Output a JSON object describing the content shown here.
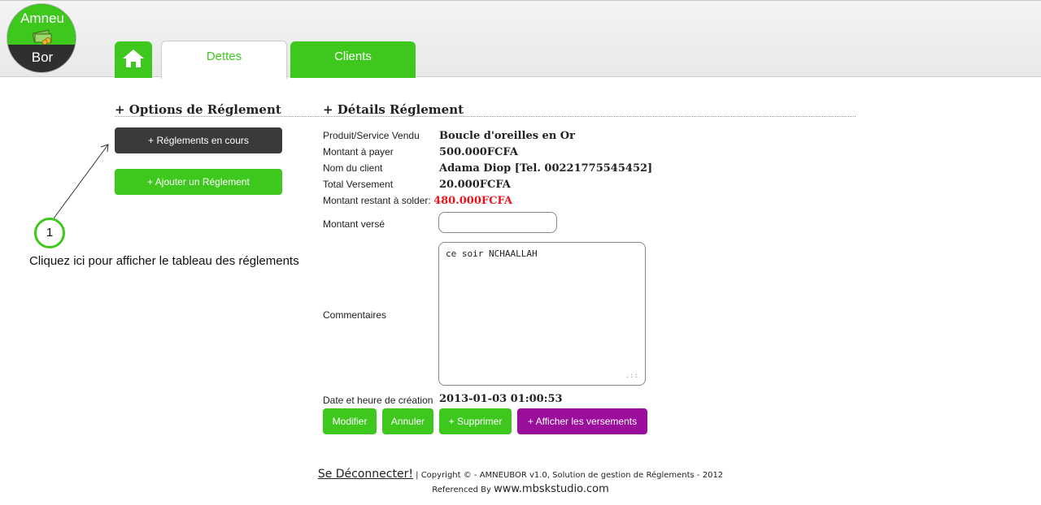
{
  "logo": {
    "line1": "Amneu",
    "line2": "Bor",
    "icon": "money-icon"
  },
  "tabs": {
    "home_icon": "home-icon",
    "dettes": "Dettes",
    "clients": "Clients"
  },
  "options": {
    "title": "+ Options de Réglement",
    "reglements_en_cours": "+ Réglements en cours",
    "ajouter_reglement": "+ Ajouter un Réglement"
  },
  "annotation": {
    "number": "1",
    "text": "Cliquez ici pour afficher le tableau des réglements"
  },
  "details": {
    "title": "+ Détails Réglement",
    "produit_label": "Produit/Service Vendu",
    "produit_value": "Boucle d'oreilles en Or",
    "montant_label": "Montant à payer",
    "montant_value": "500.000FCFA",
    "client_label": "Nom du client",
    "client_value": "Adama Diop [Tel. 00221775545452]",
    "versement_label": "Total Versement",
    "versement_value": "20.000FCFA",
    "restant_label": "Montant restant à solder:",
    "restant_value": "480.000FCFA",
    "verse_label": "Montant versé",
    "verse_value": "",
    "commentaires_label": "Commentaires",
    "commentaires_value": "ce soir NCHAALLAH",
    "date_label": "Date et heure de création",
    "date_value": "2013-01-03 01:00:53"
  },
  "actions": {
    "modifier": "Modifier",
    "annuler": "Annuler",
    "supprimer": "+ Supprimer",
    "afficher_versements": "+ Afficher les versements"
  },
  "footer": {
    "logout": "Se Déconnecter!",
    "copyright": "| Copyright © - AMNEUBOR v1.0, Solution de gestion de Réglements - 2012",
    "referenced": "Referenced By",
    "site": "www.mbskstudio.com"
  },
  "colors": {
    "accent_green": "#3ec81e",
    "dark_button": "#3a3a3a",
    "purple_button": "#9b0d9b",
    "alert_red": "#e8141b"
  }
}
